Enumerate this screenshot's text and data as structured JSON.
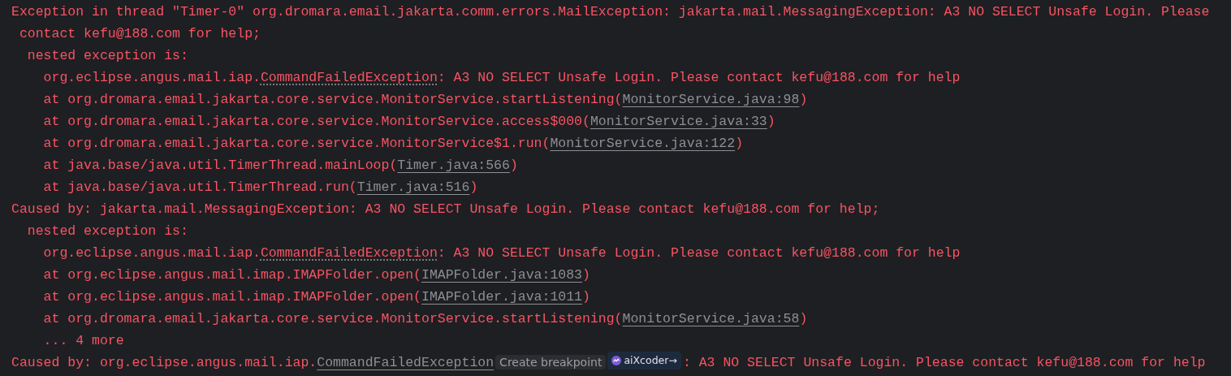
{
  "console": {
    "lines": [
      {
        "segments": [
          {
            "kind": "plain",
            "text": "Exception in thread \"Timer-0\" org.dromara.email.jakarta.comm.errors.MailException: jakarta.mail.MessagingException: A3 NO SELECT Unsafe Login. Please"
          }
        ]
      },
      {
        "segments": [
          {
            "kind": "plain",
            "text": " contact kefu@188.com for help;"
          }
        ]
      },
      {
        "segments": [
          {
            "kind": "plain",
            "text": "  nested exception is:"
          }
        ]
      },
      {
        "segments": [
          {
            "kind": "plain",
            "text": "    org.eclipse.angus.mail.iap."
          },
          {
            "kind": "class",
            "text": "CommandFailedException"
          },
          {
            "kind": "plain",
            "text": ": A3 NO SELECT Unsafe Login. Please contact kefu@188.com for help"
          }
        ]
      },
      {
        "segments": [
          {
            "kind": "plain",
            "text": "    at org.dromara.email.jakarta.core.service.MonitorService.startListening("
          },
          {
            "kind": "link",
            "text": "MonitorService.java:98"
          },
          {
            "kind": "plain",
            "text": ")"
          }
        ]
      },
      {
        "segments": [
          {
            "kind": "plain",
            "text": "    at org.dromara.email.jakarta.core.service.MonitorService.access$000("
          },
          {
            "kind": "link",
            "text": "MonitorService.java:33"
          },
          {
            "kind": "plain",
            "text": ")"
          }
        ]
      },
      {
        "segments": [
          {
            "kind": "plain",
            "text": "    at org.dromara.email.jakarta.core.service.MonitorService$1.run("
          },
          {
            "kind": "link",
            "text": "MonitorService.java:122"
          },
          {
            "kind": "plain",
            "text": ")"
          }
        ]
      },
      {
        "segments": [
          {
            "kind": "plain",
            "text": "    at java.base/java.util.TimerThread.mainLoop("
          },
          {
            "kind": "link",
            "text": "Timer.java:566"
          },
          {
            "kind": "plain",
            "text": ")"
          }
        ]
      },
      {
        "segments": [
          {
            "kind": "plain",
            "text": "    at java.base/java.util.TimerThread.run("
          },
          {
            "kind": "link",
            "text": "Timer.java:516"
          },
          {
            "kind": "plain",
            "text": ")"
          }
        ]
      },
      {
        "segments": [
          {
            "kind": "plain",
            "text": "Caused by: jakarta.mail.MessagingException: A3 NO SELECT Unsafe Login. Please contact kefu@188.com for help;"
          }
        ]
      },
      {
        "segments": [
          {
            "kind": "plain",
            "text": "  nested exception is:"
          }
        ]
      },
      {
        "segments": [
          {
            "kind": "plain",
            "text": "    org.eclipse.angus.mail.iap."
          },
          {
            "kind": "class",
            "text": "CommandFailedException"
          },
          {
            "kind": "plain",
            "text": ": A3 NO SELECT Unsafe Login. Please contact kefu@188.com for help"
          }
        ]
      },
      {
        "segments": [
          {
            "kind": "plain",
            "text": "    at org.eclipse.angus.mail.imap.IMAPFolder.open("
          },
          {
            "kind": "link",
            "text": "IMAPFolder.java:1083"
          },
          {
            "kind": "plain",
            "text": ")"
          }
        ]
      },
      {
        "segments": [
          {
            "kind": "plain",
            "text": "    at org.eclipse.angus.mail.imap.IMAPFolder.open("
          },
          {
            "kind": "link",
            "text": "IMAPFolder.java:1011"
          },
          {
            "kind": "plain",
            "text": ")"
          }
        ]
      },
      {
        "segments": [
          {
            "kind": "plain",
            "text": "    at org.dromara.email.jakarta.core.service.MonitorService.startListening("
          },
          {
            "kind": "link",
            "text": "MonitorService.java:58"
          },
          {
            "kind": "plain",
            "text": ")"
          }
        ]
      },
      {
        "segments": [
          {
            "kind": "plain",
            "text": "    ... 4 more"
          }
        ]
      },
      {
        "segments": [
          {
            "kind": "plain",
            "text": "Caused by: org.eclipse.angus.mail.iap."
          },
          {
            "kind": "link",
            "text": "CommandFailedException"
          },
          {
            "kind": "hint",
            "text": "Create breakpoint"
          },
          {
            "kind": "badge",
            "text": "aiXcoder",
            "arrow": "→"
          },
          {
            "kind": "plain",
            "text": ": A3 NO SELECT Unsafe Login. Please contact kefu@188.com for help"
          }
        ]
      }
    ]
  }
}
